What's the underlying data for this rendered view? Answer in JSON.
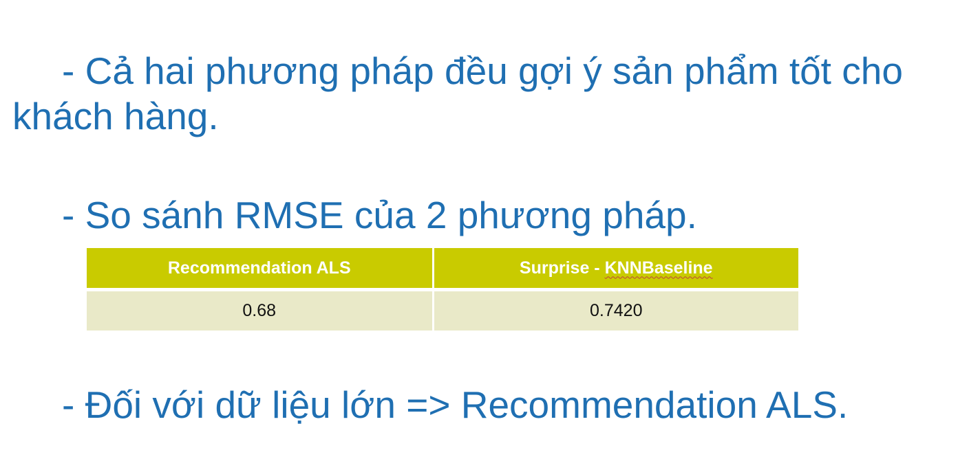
{
  "bullets": [
    "- Cả hai phương pháp đều gợi ý sản phẩm tốt cho khách hàng.",
    "- So sánh RMSE của 2 phương pháp.",
    "- Đối với dữ liệu lớn => Recommendation ALS."
  ],
  "table": {
    "headers": [
      "Recommendation ALS",
      "Surprise - ",
      "KNNBaseline"
    ],
    "rows": [
      [
        "0.68",
        "0.7420"
      ]
    ]
  },
  "colors": {
    "text": "#1f6fb2",
    "header_bg": "#c9cb00",
    "cell_bg": "#e9e9c8"
  }
}
